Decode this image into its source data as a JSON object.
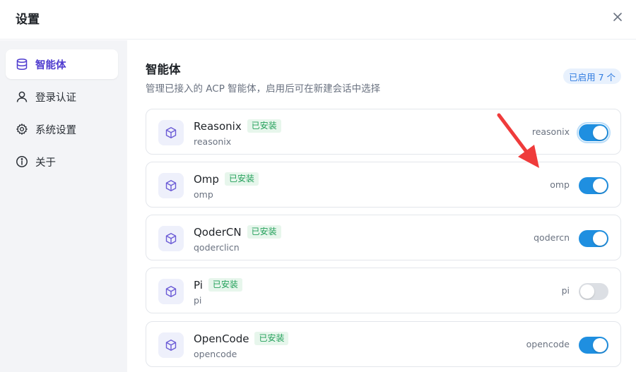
{
  "window": {
    "title": "设置"
  },
  "sidebar": {
    "items": [
      {
        "label": "智能体",
        "icon": "database-icon",
        "active": true
      },
      {
        "label": "登录认证",
        "icon": "user-icon",
        "active": false
      },
      {
        "label": "系统设置",
        "icon": "gear-icon",
        "active": false
      },
      {
        "label": "关于",
        "icon": "info-icon",
        "active": false
      }
    ]
  },
  "main": {
    "title": "智能体",
    "description": "管理已接入的 ACP 智能体，启用后可在新建会话中选择",
    "count_badge": "已启用 7 个",
    "agents": [
      {
        "name": "Reasonix",
        "status": "已安装",
        "sub": "reasonix",
        "key": "reasonix",
        "enabled": true
      },
      {
        "name": "Omp",
        "status": "已安装",
        "sub": "omp",
        "key": "omp",
        "enabled": true
      },
      {
        "name": "QoderCN",
        "status": "已安装",
        "sub": "qoderclicn",
        "key": "qodercn",
        "enabled": true
      },
      {
        "name": "Pi",
        "status": "已安装",
        "sub": "pi",
        "key": "pi",
        "enabled": false
      },
      {
        "name": "OpenCode",
        "status": "已安装",
        "sub": "opencode",
        "key": "opencode",
        "enabled": true
      }
    ]
  },
  "colors": {
    "accent": "#4f3ccf",
    "toggle_on": "#1f8fe0",
    "installed": "#23a05a",
    "annotation_arrow": "#ef3b3b"
  }
}
